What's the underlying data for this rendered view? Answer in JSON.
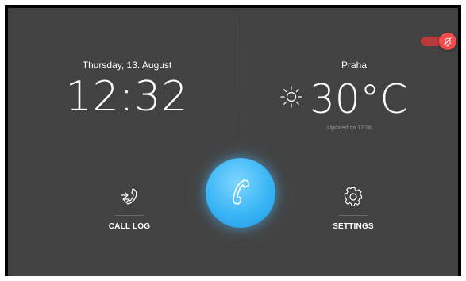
{
  "home": {
    "date": "Thursday, 13. August",
    "time": "12:32"
  },
  "weather": {
    "city": "Praha",
    "temperature": "30°C",
    "updated": "Updated on 12:26",
    "icon": "sun-icon"
  },
  "do_not_disturb": {
    "enabled": true,
    "icon": "bell-off-icon",
    "color": "#f24b4b"
  },
  "call_button": {
    "icon": "phone-handset-icon",
    "color": "#3ab5f5"
  },
  "actions": {
    "call_log": {
      "label": "CALL LOG",
      "icon": "call-log-arrows-icon"
    },
    "settings": {
      "label": "SETTINGS",
      "icon": "gear-icon"
    }
  }
}
